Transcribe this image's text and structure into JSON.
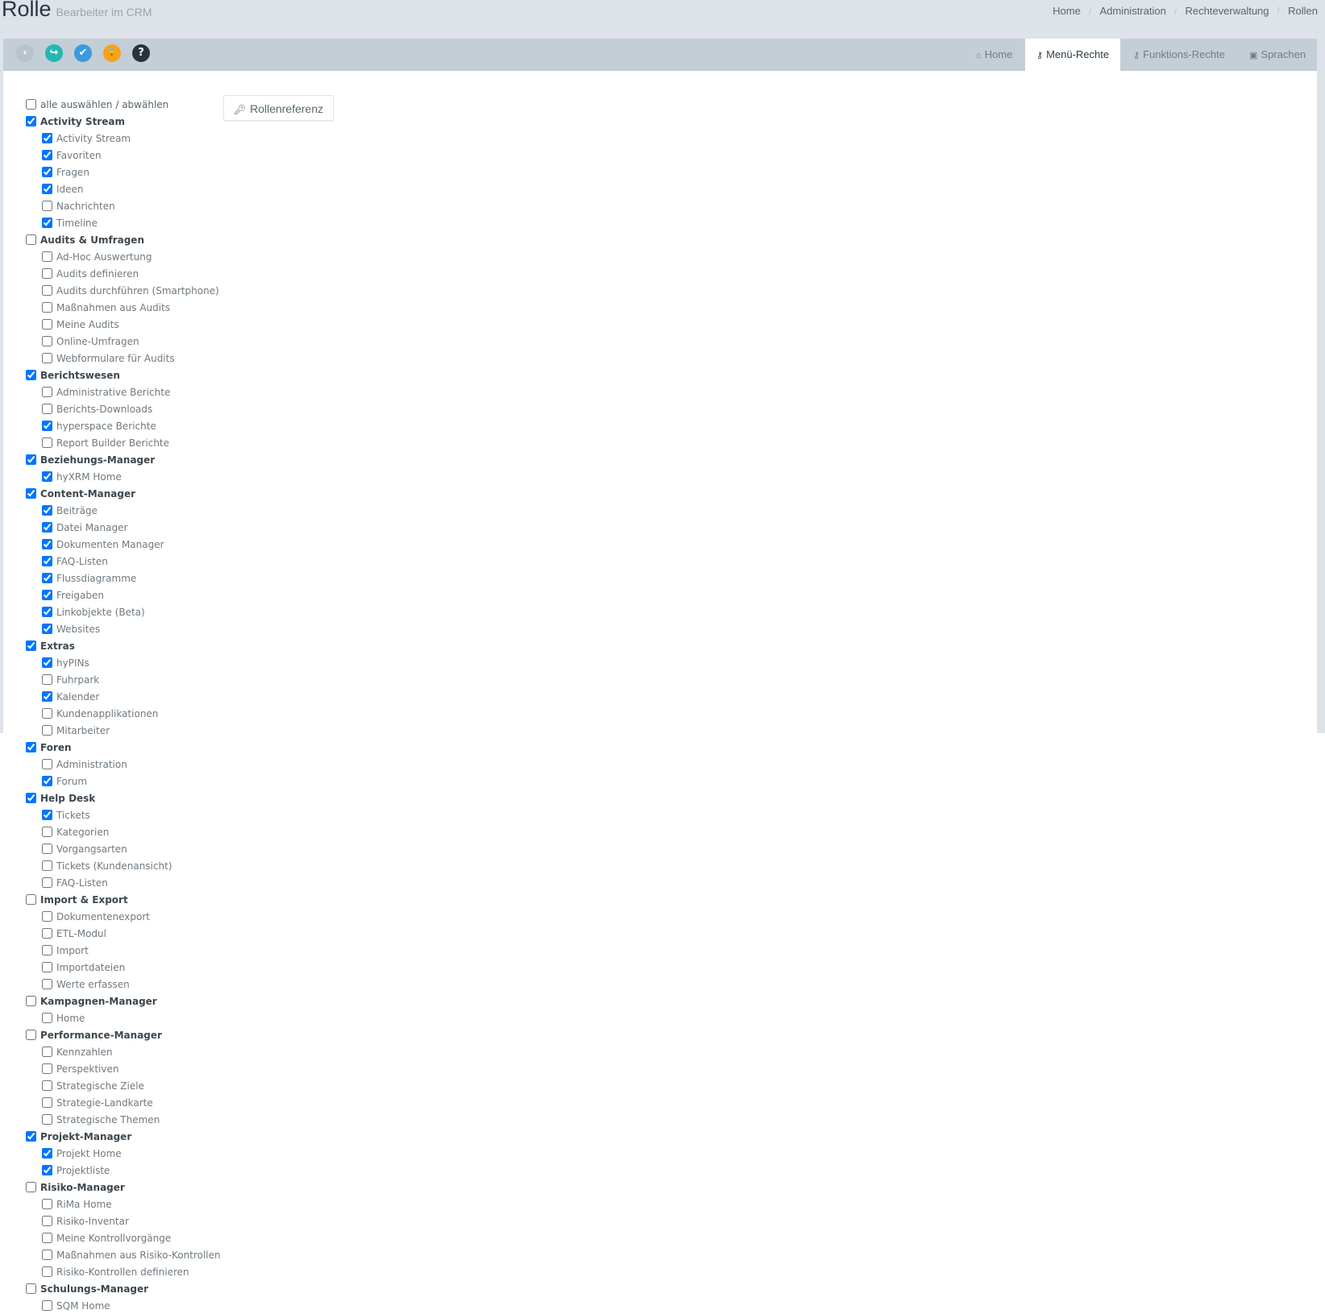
{
  "header": {
    "title": "Rolle",
    "subtitle": "Bearbeiter im CRM",
    "breadcrumb": [
      "Home",
      "Administration",
      "Rechteverwaltung",
      "Rollen"
    ]
  },
  "toolbar": {
    "buttons": [
      {
        "name": "back",
        "color": "#b9c3ca",
        "glyph": "‹"
      },
      {
        "name": "share",
        "color": "#23b7b3",
        "glyph": "↪"
      },
      {
        "name": "check",
        "color": "#3a9be0",
        "glyph": "✔"
      },
      {
        "name": "unlock",
        "color": "#f7a21b",
        "glyph": "🔓"
      },
      {
        "name": "help",
        "color": "#2b333a",
        "glyph": "?"
      }
    ],
    "tabs": [
      {
        "label": "Home",
        "icon": "home-icon",
        "active": false
      },
      {
        "label": "Menü-Rechte",
        "icon": "key-icon",
        "active": true
      },
      {
        "label": "Funktions-Rechte",
        "icon": "key-icon",
        "active": false
      },
      {
        "label": "Sprachen",
        "icon": "language-icon",
        "active": false
      }
    ]
  },
  "select_all_label": "alle auswählen / abwählen",
  "rollenreferenz_label": "Rollenreferenz",
  "groups": [
    {
      "label": "Activity Stream",
      "checked": true,
      "items": [
        {
          "label": "Activity Stream",
          "checked": true
        },
        {
          "label": "Favoriten",
          "checked": true
        },
        {
          "label": "Fragen",
          "checked": true
        },
        {
          "label": "Ideen",
          "checked": true
        },
        {
          "label": "Nachrichten",
          "checked": false
        },
        {
          "label": "Timeline",
          "checked": true
        }
      ]
    },
    {
      "label": "Audits & Umfragen",
      "checked": false,
      "items": [
        {
          "label": "Ad-Hoc Auswertung",
          "checked": false
        },
        {
          "label": "Audits definieren",
          "checked": false
        },
        {
          "label": "Audits durchführen (Smartphone)",
          "checked": false
        },
        {
          "label": "Maßnahmen aus Audits",
          "checked": false
        },
        {
          "label": "Meine Audits",
          "checked": false
        },
        {
          "label": "Online-Umfragen",
          "checked": false
        },
        {
          "label": "Webformulare für Audits",
          "checked": false
        }
      ]
    },
    {
      "label": "Berichtswesen",
      "checked": true,
      "items": [
        {
          "label": "Administrative Berichte",
          "checked": false
        },
        {
          "label": "Berichts-Downloads",
          "checked": false
        },
        {
          "label": "hyperspace Berichte",
          "checked": true
        },
        {
          "label": "Report Builder Berichte",
          "checked": false
        }
      ]
    },
    {
      "label": "Beziehungs-Manager",
      "checked": true,
      "items": [
        {
          "label": "hyXRM Home",
          "checked": true
        }
      ]
    },
    {
      "label": "Content-Manager",
      "checked": true,
      "items": [
        {
          "label": "Beiträge",
          "checked": true
        },
        {
          "label": "Datei Manager",
          "checked": true
        },
        {
          "label": "Dokumenten Manager",
          "checked": true
        },
        {
          "label": "FAQ-Listen",
          "checked": true
        },
        {
          "label": "Flussdiagramme",
          "checked": true
        },
        {
          "label": "Freigaben",
          "checked": true
        },
        {
          "label": "Linkobjekte (Beta)",
          "checked": true
        },
        {
          "label": "Websites",
          "checked": true
        }
      ]
    },
    {
      "label": "Extras",
      "checked": true,
      "items": [
        {
          "label": "hyPINs",
          "checked": true
        },
        {
          "label": "Fuhrpark",
          "checked": false
        },
        {
          "label": "Kalender",
          "checked": true
        },
        {
          "label": "Kundenapplikationen",
          "checked": false
        },
        {
          "label": "Mitarbeiter",
          "checked": false
        }
      ]
    },
    {
      "label": "Foren",
      "checked": true,
      "items": [
        {
          "label": "Administration",
          "checked": false
        },
        {
          "label": "Forum",
          "checked": true
        }
      ]
    },
    {
      "label": "Help Desk",
      "checked": true,
      "items": [
        {
          "label": "Tickets",
          "checked": true
        },
        {
          "label": "Kategorien",
          "checked": false
        },
        {
          "label": "Vorgangsarten",
          "checked": false
        },
        {
          "label": "Tickets (Kundenansicht)",
          "checked": false
        },
        {
          "label": "FAQ-Listen",
          "checked": false
        }
      ]
    },
    {
      "label": "Import & Export",
      "checked": false,
      "items": [
        {
          "label": "Dokumentenexport",
          "checked": false
        },
        {
          "label": "ETL-Modul",
          "checked": false
        },
        {
          "label": "Import",
          "checked": false
        },
        {
          "label": "Importdateien",
          "checked": false
        },
        {
          "label": "Werte erfassen",
          "checked": false
        }
      ]
    },
    {
      "label": "Kampagnen-Manager",
      "checked": false,
      "items": [
        {
          "label": "Home",
          "checked": false
        }
      ]
    },
    {
      "label": "Performance-Manager",
      "checked": false,
      "items": [
        {
          "label": "Kennzahlen",
          "checked": false
        },
        {
          "label": "Perspektiven",
          "checked": false
        },
        {
          "label": "Strategische Ziele",
          "checked": false
        },
        {
          "label": "Strategie-Landkarte",
          "checked": false
        },
        {
          "label": "Strategische Themen",
          "checked": false
        }
      ]
    },
    {
      "label": "Projekt-Manager",
      "checked": true,
      "items": [
        {
          "label": "Projekt Home",
          "checked": true
        },
        {
          "label": "Projektliste",
          "checked": true
        }
      ]
    },
    {
      "label": "Risiko-Manager",
      "checked": false,
      "items": [
        {
          "label": "RiMa Home",
          "checked": false
        },
        {
          "label": "Risiko-Inventar",
          "checked": false
        },
        {
          "label": "Meine Kontrollvorgänge",
          "checked": false
        },
        {
          "label": "Maßnahmen aus Risiko-Kontrollen",
          "checked": false
        },
        {
          "label": "Risiko-Kontrollen definieren",
          "checked": false
        }
      ]
    },
    {
      "label": "Schulungs-Manager",
      "checked": false,
      "items": [
        {
          "label": "SQM Home",
          "checked": false
        }
      ]
    }
  ]
}
